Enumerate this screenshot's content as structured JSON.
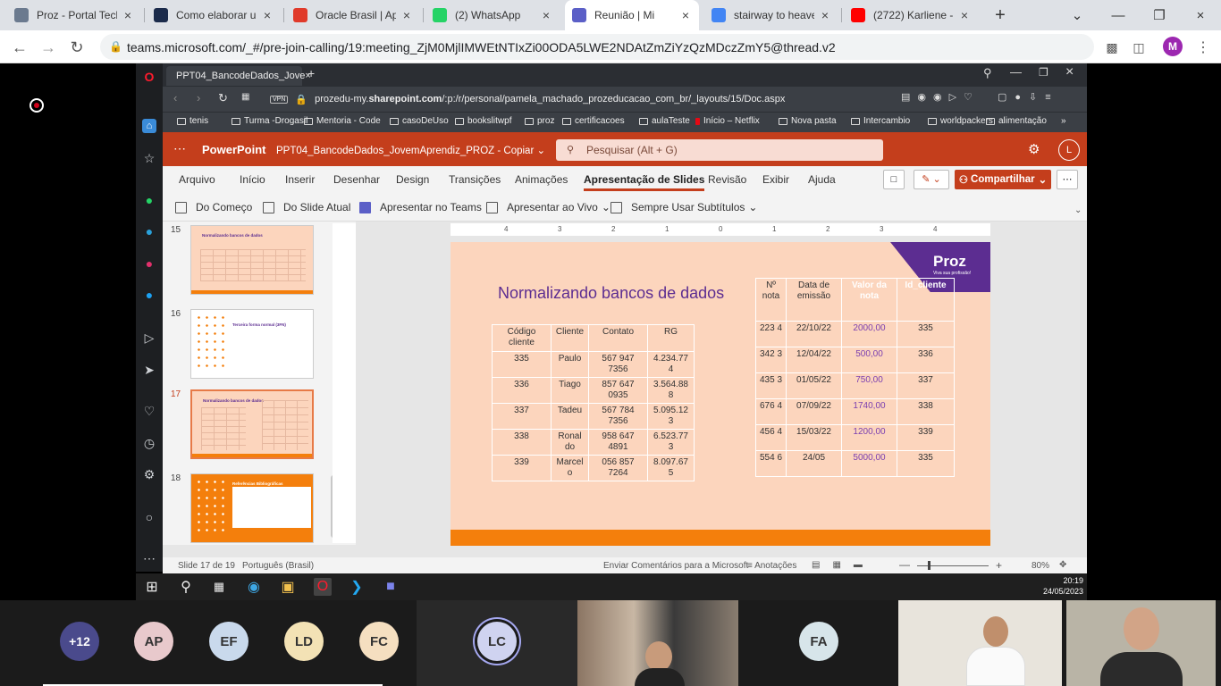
{
  "browser": {
    "tabs": [
      {
        "title": "Proz - Portal Tech",
        "color": "#6b7a8f"
      },
      {
        "title": "Como elaborar um",
        "color": "#1b2b4b"
      },
      {
        "title": "Oracle Brasil | Ap",
        "color": "#e03a2a"
      },
      {
        "title": "(2) WhatsApp",
        "color": "#25d366"
      },
      {
        "title": "Reunião | Mi",
        "color": "#5b5fc7"
      },
      {
        "title": "stairway to heave",
        "color": "#4285f4"
      },
      {
        "title": "(2722) Karliene -",
        "color": "#ff0000"
      }
    ],
    "url": "teams.microsoft.com/_#/pre-join-calling/19:meeting_ZjM0MjlIMWEtNTIxZi00ODA5LWE2NDAtZmZiYzQzMDczZmY5@thread.v2",
    "profile_initial": "M"
  },
  "opera": {
    "tab_title": "PPT04_BancodeDados_Jove",
    "url_prefix": "prozedu-my.",
    "url_domain": "sharepoint.com",
    "url_rest": "/:p:/r/personal/pamela_machado_prozeducacao_com_br/_layouts/15/Doc.aspx",
    "vpn": "VPN",
    "bookmarks": [
      "tenis",
      "Turma -Drogasil",
      "Mentoria - Code",
      "casoDeUso",
      "bookslitwpf",
      "proz",
      "certificacoes",
      "aulaTeste",
      "Início – Netflix",
      "Nova pasta",
      "Intercambio",
      "worldpackers",
      "alimentação"
    ]
  },
  "powerpoint": {
    "app_name": "PowerPoint",
    "doc_title": "PPT04_BancodeDados_JovemAprendiz_PROZ - Copiar",
    "search_placeholder": "Pesquisar (Alt + G)",
    "user_initial": "L",
    "ribbon_tabs": [
      "Arquivo",
      "Início",
      "Inserir",
      "Desenhar",
      "Design",
      "Transições",
      "Animações",
      "Apresentação de Slides",
      "Revisão",
      "Exibir",
      "Ajuda"
    ],
    "share_label": "Compartilhar",
    "commands": [
      "Do Começo",
      "Do Slide Atual",
      "Apresentar no Teams",
      "Apresentar ao Vivo",
      "Sempre Usar Subtítulos"
    ],
    "thumbnails": [
      {
        "num": "15",
        "title": "Normalizando bancos de dados"
      },
      {
        "num": "16",
        "title": "Terceira forma normal (3FN)"
      },
      {
        "num": "17",
        "title": "Normalizando bancos de dados"
      },
      {
        "num": "18",
        "title": "Referências Bibliográficas"
      }
    ],
    "status": {
      "slide": "Slide 17 de 19",
      "language": "Português (Brasil)",
      "feedback": "Enviar Comentários para a Microsoft",
      "notes": "Anotações",
      "zoom": "80%"
    },
    "ruler": [
      "4",
      "3",
      "2",
      "1",
      "0",
      "1",
      "2",
      "3",
      "4"
    ]
  },
  "slide": {
    "logo": "Proz",
    "logo_sub": "Viva sua profissão!",
    "title": "Normalizando bancos de dados",
    "table1": {
      "headers": [
        "Código cliente",
        "Cliente",
        "Contato",
        "RG"
      ],
      "rows": [
        [
          "335",
          "Paulo",
          "567 947 7356",
          "4.234.77 4"
        ],
        [
          "336",
          "Tiago",
          "857 647 0935",
          "3.564.88 8"
        ],
        [
          "337",
          "Tadeu",
          "567 784 7356",
          "5.095.12 3"
        ],
        [
          "338",
          "Ronal do",
          "958 647 4891",
          "6.523.77 3"
        ],
        [
          "339",
          "Marcel o",
          "056 857 7264",
          "8.097.67 5"
        ]
      ]
    },
    "table2": {
      "headers": [
        "Nº nota",
        "Data de emissão",
        "Valor da nota",
        "Id_cliente"
      ],
      "rows": [
        [
          "223 4",
          "22/10/22",
          "2000,00",
          "335"
        ],
        [
          "342 3",
          "12/04/22",
          "500,00",
          "336"
        ],
        [
          "435 3",
          "01/05/22",
          "750,00",
          "337"
        ],
        [
          "676 4",
          "07/09/22",
          "1740,00",
          "338"
        ],
        [
          "456 4",
          "15/03/22",
          "1200,00",
          "339"
        ],
        [
          "554 6",
          "24/05",
          "5000,00",
          "335"
        ]
      ]
    }
  },
  "taskbar": {
    "time": "20:19",
    "date": "24/05/2023"
  },
  "participants": [
    {
      "initials": "+12",
      "bg": "#4a4a8c",
      "fg": "#ffffff"
    },
    {
      "initials": "AP",
      "bg": "#e8c9cc",
      "fg": "#333333"
    },
    {
      "initials": "EF",
      "bg": "#c9d9ec",
      "fg": "#333333"
    },
    {
      "initials": "LD",
      "bg": "#f3e2b5",
      "fg": "#333333"
    },
    {
      "initials": "FC",
      "bg": "#f5dfc0",
      "fg": "#333333"
    },
    {
      "initials": "LC",
      "bg": "#cfd3f0",
      "fg": "#333333"
    },
    {
      "initials": "FA",
      "bg": "#d7e5ea",
      "fg": "#333333"
    }
  ]
}
